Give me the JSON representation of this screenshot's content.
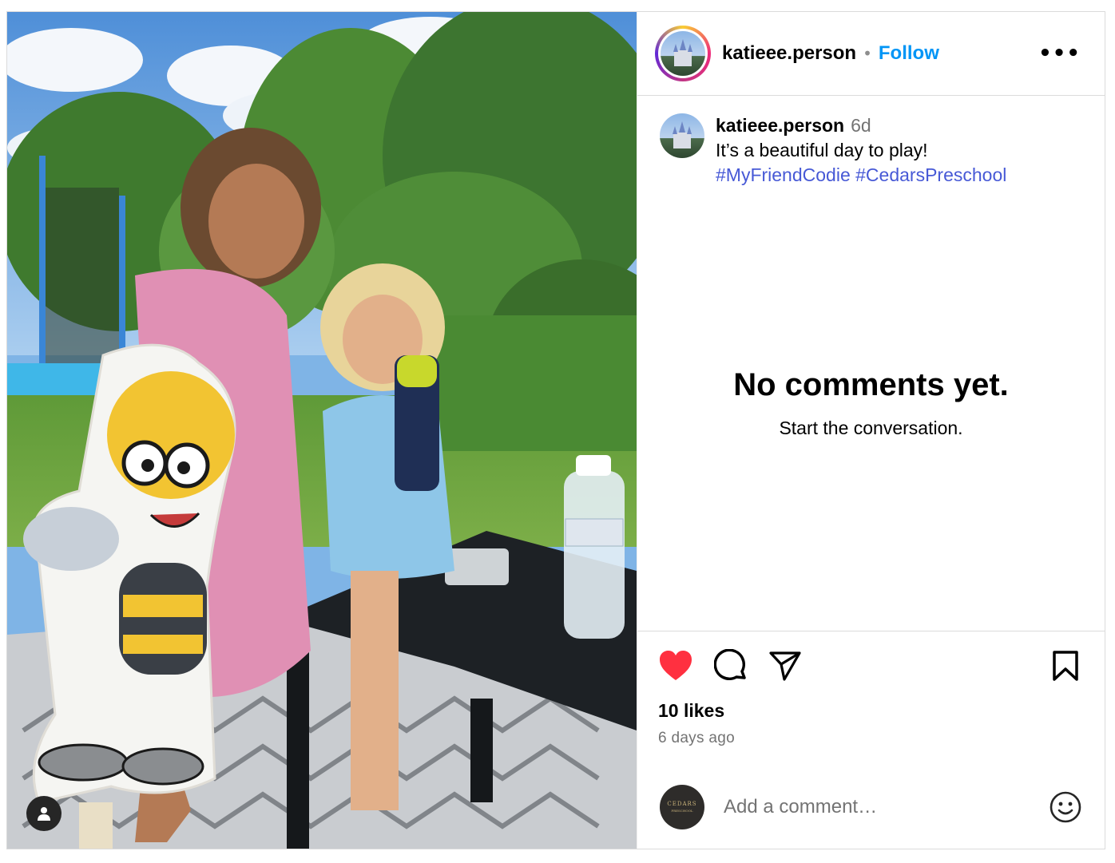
{
  "post": {
    "author": "katieee.person",
    "follow_label": "Follow",
    "separator": "•",
    "more_label": "•••",
    "caption": {
      "username": "katieee.person",
      "time": "6d",
      "text": "It’s a beautiful day to play!",
      "hashtags": [
        "#MyFriendCodie",
        "#CedarsPreschool"
      ]
    },
    "empty_comments": {
      "title": "No comments yet.",
      "subtitle": "Start the conversation."
    },
    "liked": true,
    "likes_label": "10 likes",
    "time_ago": "6 days ago",
    "comment_placeholder": "Add a comment…",
    "my_avatar_text": "CEDARS",
    "my_avatar_subtext": "PRESCHOOL"
  },
  "colors": {
    "like_red": "#ff3040",
    "follow_blue": "#0095f6",
    "hashtag_blue": "#4759d6"
  },
  "icons": {
    "like": "heart-icon",
    "comment": "comment-icon",
    "share": "send-icon",
    "save": "bookmark-icon",
    "emoji": "emoji-icon",
    "tagged_user": "person-icon",
    "more": "more-icon"
  }
}
